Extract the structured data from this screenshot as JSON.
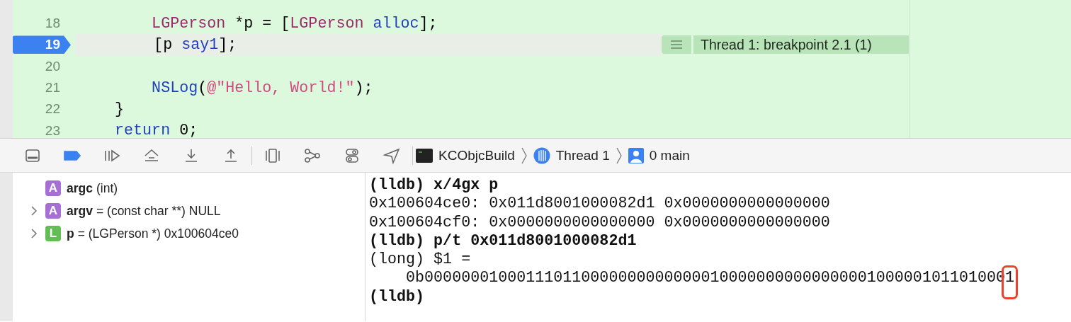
{
  "editor": {
    "lines": [
      {
        "number": "18",
        "current": false,
        "tokens": [
          {
            "text": "        LGPerson",
            "kind": "type"
          },
          {
            "text": " *p = [",
            "kind": "plain"
          },
          {
            "text": "LGPerson",
            "kind": "type"
          },
          {
            "text": " alloc",
            "kind": "method"
          },
          {
            "text": "];",
            "kind": "plain"
          }
        ]
      },
      {
        "number": "19",
        "current": true,
        "breakpoint": true,
        "tokens": [
          {
            "text": "        [p ",
            "kind": "plain"
          },
          {
            "text": "say1",
            "kind": "method"
          },
          {
            "text": "];",
            "kind": "plain"
          }
        ],
        "annotation": "Thread 1: breakpoint 2.1 (1)"
      },
      {
        "number": "20",
        "current": false
      },
      {
        "number": "21",
        "current": false,
        "tokens": [
          {
            "text": "        NSLog",
            "kind": "method"
          },
          {
            "text": "(",
            "kind": "plain"
          },
          {
            "text": "@\"Hello, World!\"",
            "kind": "string"
          },
          {
            "text": ");",
            "kind": "plain"
          }
        ]
      },
      {
        "number": "22",
        "current": false,
        "tokens": [
          {
            "text": "    }",
            "kind": "plain"
          }
        ]
      },
      {
        "number": "23",
        "current": false,
        "tokens": [
          {
            "text": "    return",
            "kind": "keyword"
          },
          {
            "text": " 0;",
            "kind": "plain"
          }
        ]
      }
    ]
  },
  "debug_bar": {
    "breakpoints_active": true,
    "breadcrumb": [
      {
        "kind": "target",
        "label": "KCObjcBuild"
      },
      {
        "kind": "thread",
        "label": "Thread 1"
      },
      {
        "kind": "frame",
        "label": "0 main"
      }
    ]
  },
  "variables": [
    {
      "kind": "argument",
      "badge": "A",
      "name": "argc",
      "detail": "(int)",
      "has_children": false
    },
    {
      "kind": "argument",
      "badge": "A",
      "name": "argv",
      "detail": "= (const char **) NULL",
      "has_children": true
    },
    {
      "kind": "local",
      "badge": "L",
      "name": "p",
      "detail": "= (LGPerson *) 0x100604ce0",
      "has_children": true
    }
  ],
  "console": [
    {
      "kind": "command",
      "text": "(lldb) x/4gx p"
    },
    {
      "kind": "output",
      "text": "0x100604ce0: 0x011d8001000082d1 0x0000000000000000"
    },
    {
      "kind": "output",
      "text": "0x100604cf0: 0x0000000000000000 0x0000000000000000"
    },
    {
      "kind": "command",
      "text": "(lldb) p/t 0x011d8001000082d1"
    },
    {
      "kind": "output",
      "text": "(long) $1 = "
    },
    {
      "kind": "output",
      "text": "    0b0000000100011101100000000000000100000000000000001000001011010001",
      "marked": true
    },
    {
      "kind": "command",
      "text": "(lldb)"
    }
  ]
}
